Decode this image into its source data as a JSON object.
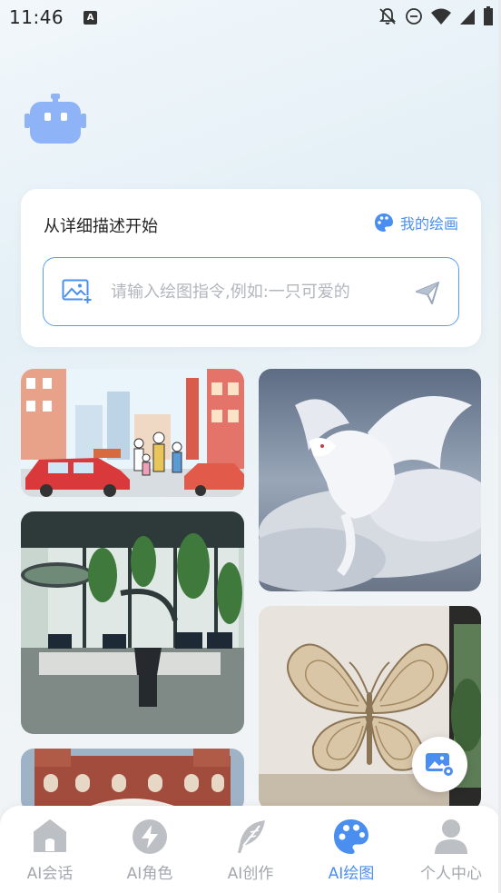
{
  "status_bar": {
    "time": "11:46",
    "notification_icon": "a-icon",
    "icons": [
      "bell-off-icon",
      "dnd-icon",
      "wifi-icon",
      "signal-icon",
      "battery-icon"
    ]
  },
  "header": {
    "logo_icon": "robot-icon"
  },
  "prompt": {
    "title": "从详细描述开始",
    "my_drawings_label": "我的绘画",
    "my_drawings_icon": "palette-icon",
    "placeholder": "请输入绘图指令,例如:一只可爱的",
    "value": "",
    "image_icon": "image-add-icon",
    "send_icon": "send-icon"
  },
  "gallery": {
    "items": [
      {
        "subject": "cartoon street scene with red car and family"
      },
      {
        "subject": "white dragon in clouds"
      },
      {
        "subject": "modern office with plants"
      },
      {
        "subject": "carved wooden butterfly wall art"
      },
      {
        "subject": "red brick building"
      }
    ]
  },
  "fab": {
    "icon": "image-settings-icon"
  },
  "tabs": [
    {
      "label": "AI会话",
      "icon": "home-icon",
      "active": false
    },
    {
      "label": "AI角色",
      "icon": "lightning-icon",
      "active": false
    },
    {
      "label": "AI创作",
      "icon": "feather-icon",
      "active": false
    },
    {
      "label": "AI绘图",
      "icon": "palette-icon",
      "active": true
    },
    {
      "label": "个人中心",
      "icon": "user-icon",
      "active": false
    }
  ],
  "colors": {
    "accent": "#4a8ff0",
    "inactive": "#a4a7ad",
    "robot": "#8fb3f7"
  }
}
